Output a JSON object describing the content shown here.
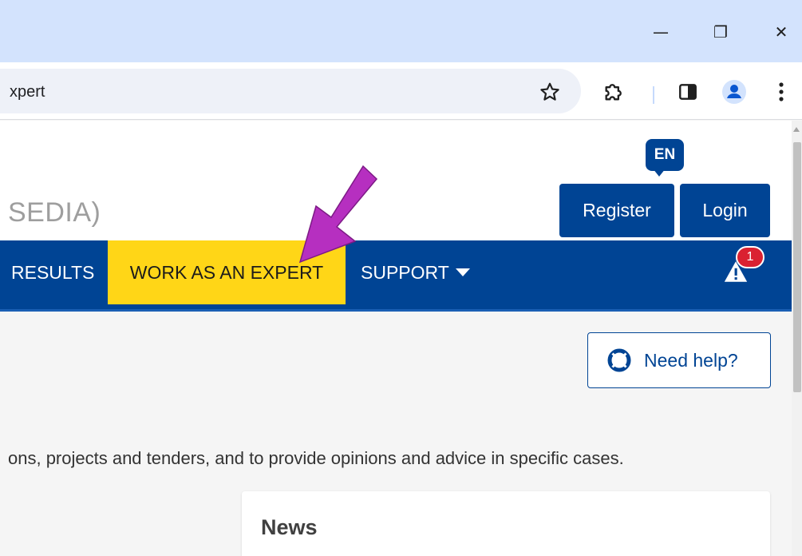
{
  "browser": {
    "address_text": "xpert",
    "window_controls": {
      "minimize": "—",
      "maximize": "❐",
      "close": "✕"
    }
  },
  "header": {
    "site_title": "SEDIA)",
    "language": "EN",
    "register_label": "Register",
    "login_label": "Login"
  },
  "nav": {
    "items": [
      {
        "label": "RESULTS"
      },
      {
        "label": "WORK AS AN EXPERT",
        "active": true
      },
      {
        "label": "SUPPORT"
      }
    ],
    "alert_count": "1"
  },
  "main": {
    "help_label": "Need help?",
    "intro_text": "ons, projects and tenders, and to provide opinions and advice in specific cases.",
    "news_title": "News"
  },
  "colors": {
    "brand_blue": "#004494",
    "active_yellow": "#ffd617",
    "annotation_arrow": "#b62fc0",
    "alert_red": "#da2131"
  }
}
